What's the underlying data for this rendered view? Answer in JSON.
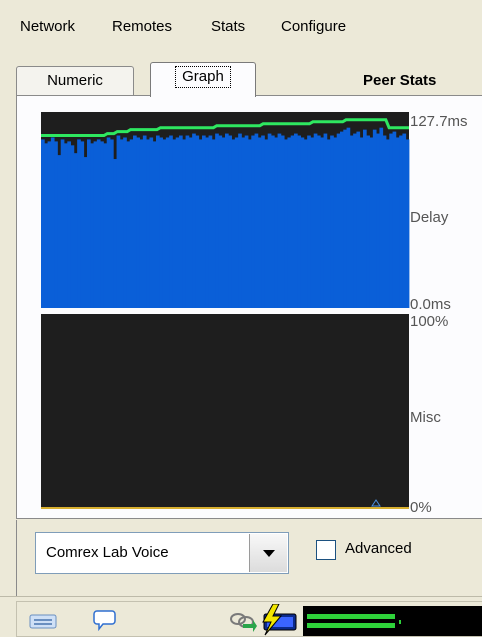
{
  "menu": {
    "items": [
      "Network",
      "Remotes",
      "Stats",
      "Configure"
    ]
  },
  "tabs": {
    "items": [
      {
        "label": "Numeric",
        "active": false
      },
      {
        "label": "Graph",
        "active": true
      }
    ],
    "panel_title": "Peer Stats"
  },
  "graph": {
    "delay": {
      "max_label": "127.7ms",
      "mid_label": "Delay",
      "min_label": "0.0ms",
      "bar_color": "#0a5fd8",
      "line_color": "#2ee860",
      "bg_color": "#1e1e1e",
      "bar_fill_fraction": [
        0.86,
        0.84,
        0.85,
        0.87,
        0.85,
        0.78,
        0.86,
        0.84,
        0.85,
        0.83,
        0.79,
        0.86,
        0.85,
        0.77,
        0.86,
        0.84,
        0.85,
        0.86,
        0.85,
        0.84,
        0.87,
        0.86,
        0.76,
        0.88,
        0.86,
        0.87,
        0.85,
        0.86,
        0.88,
        0.87,
        0.86,
        0.88,
        0.86,
        0.87,
        0.85,
        0.88,
        0.87,
        0.86,
        0.87,
        0.88,
        0.86,
        0.87,
        0.88,
        0.86,
        0.88,
        0.87,
        0.89,
        0.88,
        0.86,
        0.88,
        0.87,
        0.88,
        0.86,
        0.89,
        0.88,
        0.87,
        0.89,
        0.88,
        0.86,
        0.87,
        0.89,
        0.87,
        0.88,
        0.86,
        0.88,
        0.89,
        0.87,
        0.88,
        0.86,
        0.89,
        0.88,
        0.87,
        0.89,
        0.88,
        0.86,
        0.87,
        0.88,
        0.89,
        0.88,
        0.87,
        0.86,
        0.88,
        0.87,
        0.89,
        0.88,
        0.87,
        0.89,
        0.86,
        0.88,
        0.87,
        0.89,
        0.9,
        0.91,
        0.92,
        0.88,
        0.89,
        0.9,
        0.87,
        0.91,
        0.88,
        0.87,
        0.91,
        0.89,
        0.92,
        0.88,
        0.86,
        0.89,
        0.9,
        0.87,
        0.88,
        0.89,
        0.86
      ],
      "peak_fraction": [
        0.88,
        0.88,
        0.88,
        0.88,
        0.88,
        0.88,
        0.88,
        0.88,
        0.88,
        0.88,
        0.88,
        0.88,
        0.88,
        0.88,
        0.88,
        0.88,
        0.88,
        0.88,
        0.88,
        0.88,
        0.89,
        0.89,
        0.89,
        0.9,
        0.9,
        0.9,
        0.9,
        0.91,
        0.91,
        0.91,
        0.91,
        0.91,
        0.91,
        0.91,
        0.91,
        0.91,
        0.92,
        0.92,
        0.92,
        0.92,
        0.92,
        0.92,
        0.92,
        0.92,
        0.92,
        0.92,
        0.92,
        0.92,
        0.92,
        0.92,
        0.92,
        0.92,
        0.92,
        0.93,
        0.93,
        0.93,
        0.93,
        0.93,
        0.93,
        0.93,
        0.93,
        0.93,
        0.93,
        0.93,
        0.93,
        0.93,
        0.93,
        0.94,
        0.94,
        0.94,
        0.94,
        0.94,
        0.94,
        0.94,
        0.94,
        0.94,
        0.94,
        0.94,
        0.94,
        0.94,
        0.94,
        0.94,
        0.95,
        0.95,
        0.95,
        0.95,
        0.95,
        0.95,
        0.95,
        0.95,
        0.95,
        0.95,
        0.96,
        0.96,
        0.96,
        0.96,
        0.96,
        0.96,
        0.96,
        0.96,
        0.96,
        0.96,
        0.96,
        0.96,
        0.96,
        0.92,
        0.92,
        0.92,
        0.92,
        0.92,
        0.92,
        0.92
      ]
    },
    "misc": {
      "max_label": "100%",
      "mid_label": "Misc",
      "min_label": "0%",
      "bg_color": "#1e1e1e",
      "baseline_color": "#d8b030"
    }
  },
  "controls": {
    "profile_select": "Comrex Lab Voice",
    "advanced_label": "Advanced",
    "advanced_checked": false
  },
  "statusbar": {
    "icons": [
      "keyboard-icon",
      "chat-bubble-icon",
      "network-link-icon",
      "power-plug-icon",
      "battery-icon",
      "level-meter"
    ]
  }
}
